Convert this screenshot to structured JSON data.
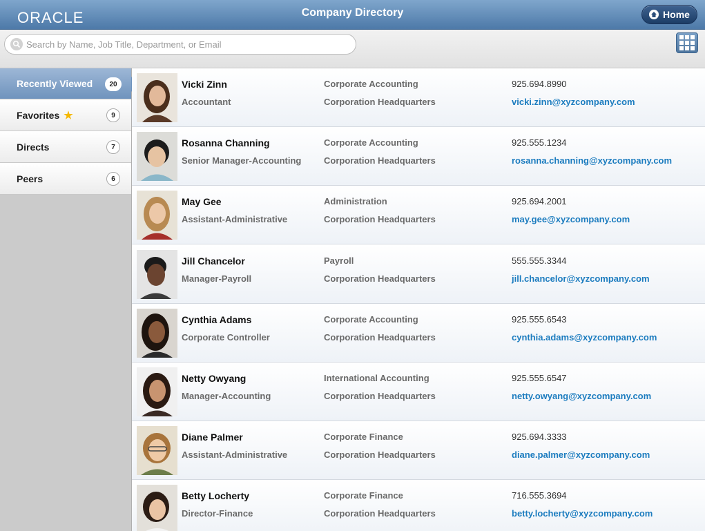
{
  "header": {
    "logo": "ORACLE",
    "title": "Company Directory",
    "home_label": "Home"
  },
  "search": {
    "placeholder": "Search by Name, Job Title, Department, or Email",
    "value": ""
  },
  "sidebar": {
    "items": [
      {
        "label": "Recently Viewed",
        "count": "20",
        "active": true
      },
      {
        "label": "Favorites",
        "count": "9",
        "active": false
      },
      {
        "label": "Directs",
        "count": "7",
        "active": false
      },
      {
        "label": "Peers",
        "count": "6",
        "active": false
      }
    ]
  },
  "people": [
    {
      "name": "Vicki Zinn",
      "title": "Accountant",
      "department": "Corporate Accounting",
      "location": "Corporation Headquarters",
      "phone": "925.694.8990",
      "email": "vicki.zinn@xyzcompany.com"
    },
    {
      "name": "Rosanna Channing",
      "title": "Senior Manager-Accounting",
      "department": "Corporate Accounting",
      "location": "Corporation Headquarters",
      "phone": "925.555.1234",
      "email": "rosanna.channing@xyzcompany.com"
    },
    {
      "name": "May Gee",
      "title": "Assistant-Administrative",
      "department": "Administration",
      "location": "Corporation Headquarters",
      "phone": "925.694.2001",
      "email": "may.gee@xyzcompany.com"
    },
    {
      "name": "Jill Chancelor",
      "title": "Manager-Payroll",
      "department": "Payroll",
      "location": "Corporation Headquarters",
      "phone": "555.555.3344",
      "email": "jill.chancelor@xyzcompany.com"
    },
    {
      "name": "Cynthia Adams",
      "title": "Corporate Controller",
      "department": "Corporate Accounting",
      "location": "Corporation Headquarters",
      "phone": "925.555.6543",
      "email": "cynthia.adams@xyzcompany.com"
    },
    {
      "name": "Netty Owyang",
      "title": "Manager-Accounting",
      "department": "International Accounting",
      "location": "Corporation Headquarters",
      "phone": "925.555.6547",
      "email": "netty.owyang@xyzcompany.com"
    },
    {
      "name": "Diane Palmer",
      "title": "Assistant-Administrative",
      "department": "Corporate Finance",
      "location": "Corporation Headquarters",
      "phone": "925.694.3333",
      "email": "diane.palmer@xyzcompany.com"
    },
    {
      "name": "Betty Locherty",
      "title": "Director-Finance",
      "department": "Corporate Finance",
      "location": "Corporation Headquarters",
      "phone": "716.555.3694",
      "email": "betty.locherty@xyzcompany.com"
    }
  ],
  "icons": {
    "home": "home-icon",
    "search": "search-icon",
    "grid": "grid-icon",
    "favorite": "star-icon"
  },
  "colors": {
    "header": "#5a84b1",
    "accent": "#1c7cbf",
    "active_sidebar": "#7f9fc6",
    "star": "#f5b800"
  }
}
